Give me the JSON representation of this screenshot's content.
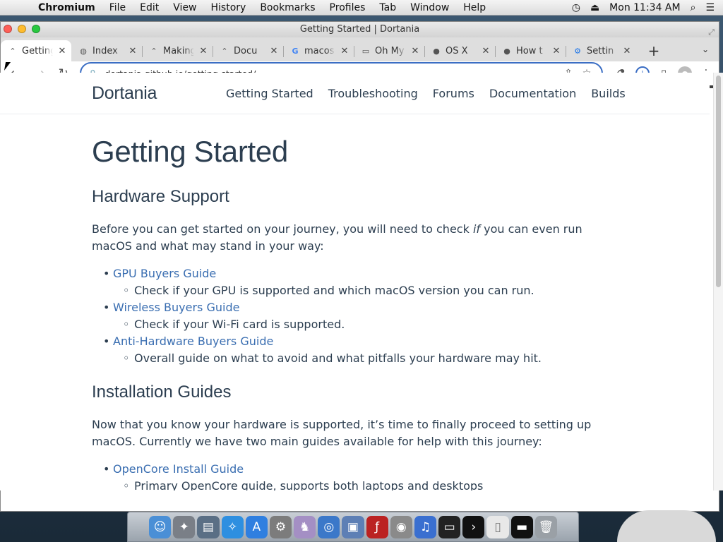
{
  "menubar": {
    "app_name": "Chromium",
    "items": [
      "File",
      "Edit",
      "View",
      "History",
      "Bookmarks",
      "Profiles",
      "Tab",
      "Window",
      "Help"
    ],
    "clock": "Mon 11:34 AM"
  },
  "window": {
    "title": "Getting Started | Dortania"
  },
  "tabs": [
    {
      "label": "Getting Started | Dortania",
      "icon": "dortania-favicon",
      "active": true
    },
    {
      "label": "Index",
      "icon": "globe-favicon"
    },
    {
      "label": "Making",
      "icon": "dortania-favicon"
    },
    {
      "label": "Docu",
      "icon": "dortania-favicon"
    },
    {
      "label": "macos",
      "icon": "google-favicon"
    },
    {
      "label": "Oh My",
      "icon": "laptop-favicon"
    },
    {
      "label": "OS X",
      "icon": "apple-favicon"
    },
    {
      "label": "How t",
      "icon": "apple-favicon"
    },
    {
      "label": "Settin",
      "icon": "gear-favicon"
    }
  ],
  "toolbar": {
    "url": "dortania.github.io/getting-started/"
  },
  "site": {
    "logo": "Dortania",
    "nav": [
      "Getting Started",
      "Troubleshooting",
      "Forums",
      "Documentation",
      "Builds"
    ]
  },
  "content": {
    "h1": "Getting Started",
    "hardware": {
      "heading": "Hardware Support",
      "intro_before": "Before you can get started on your journey, you will need to check ",
      "intro_em": "if",
      "intro_after": " you can even run macOS and what may stand in your way:",
      "items": [
        {
          "link": "GPU Buyers Guide",
          "sub": "Check if your GPU is supported and which macOS version you can run."
        },
        {
          "link": "Wireless Buyers Guide",
          "sub": "Check if your Wi-Fi card is supported."
        },
        {
          "link": "Anti-Hardware Buyers Guide",
          "sub": "Overall guide on what to avoid and what pitfalls your hardware may hit."
        }
      ]
    },
    "install": {
      "heading": "Installation Guides",
      "intro": "Now that you know your hardware is supported, it’s time to finally proceed to setting up macOS. Currently we have two main guides available for help with this journey:",
      "items": [
        {
          "link": "OpenCore Install Guide",
          "sub": "Primary OpenCore guide, supports both laptops and desktops"
        }
      ]
    }
  },
  "colors": {
    "link": "#3a6eb1",
    "text": "#2c3e50",
    "omnibox_focus": "#3b6ec4"
  }
}
